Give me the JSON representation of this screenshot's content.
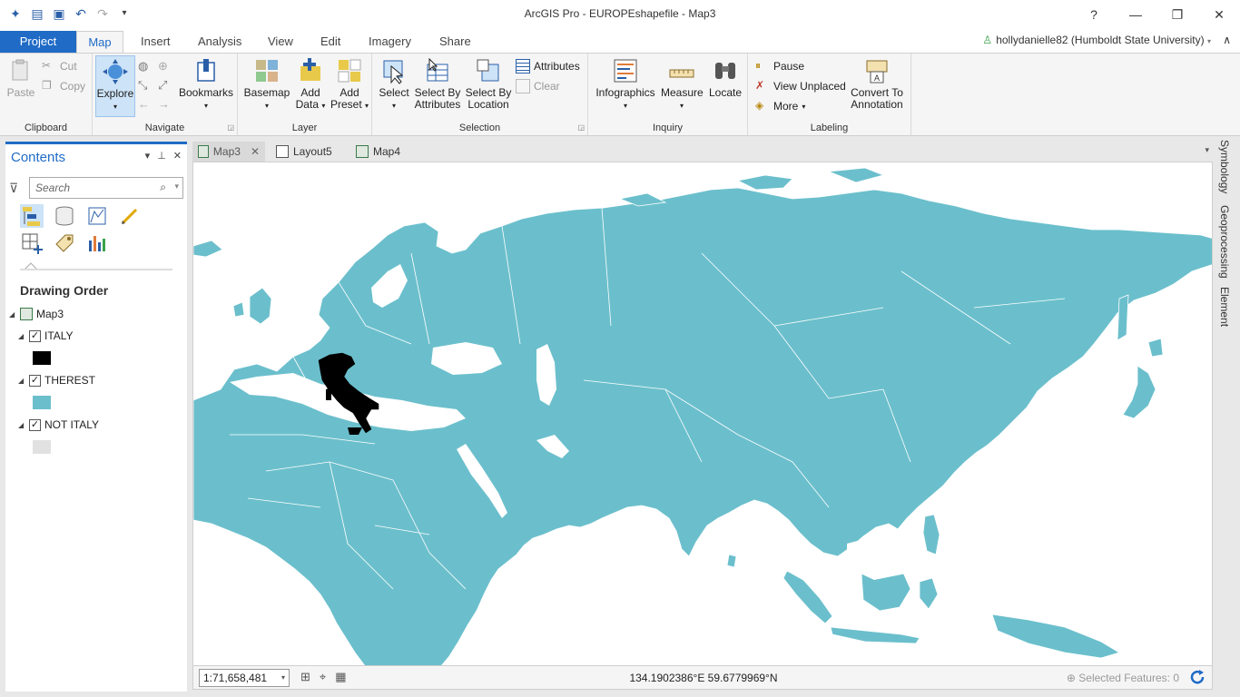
{
  "window": {
    "title": "ArcGIS Pro - EUROPEshapefile - Map3",
    "controls": {
      "help": "?",
      "minimize": "—",
      "restore": "❐",
      "close": "✕"
    }
  },
  "ribbon_tabs": [
    "Project",
    "Map",
    "Insert",
    "Analysis",
    "View",
    "Edit",
    "Imagery",
    "Share"
  ],
  "user": {
    "label": "hollydanielle82 (Humboldt State University)"
  },
  "ribbon": {
    "clipboard": {
      "label": "Clipboard",
      "paste": "Paste",
      "cut": "Cut",
      "copy": "Copy"
    },
    "navigate": {
      "label": "Navigate",
      "explore": "Explore",
      "bookmarks": "Bookmarks"
    },
    "layer": {
      "label": "Layer",
      "basemap": "Basemap",
      "add_data_1": "Add",
      "add_data_2": "Data",
      "add_preset_1": "Add",
      "add_preset_2": "Preset"
    },
    "selection": {
      "label": "Selection",
      "select": "Select",
      "sba_1": "Select By",
      "sba_2": "Attributes",
      "sbl_1": "Select By",
      "sbl_2": "Location",
      "attributes": "Attributes",
      "clear": "Clear"
    },
    "inquiry": {
      "label": "Inquiry",
      "infographics": "Infographics",
      "measure": "Measure",
      "locate": "Locate"
    },
    "labeling": {
      "label": "Labeling",
      "pause": "Pause",
      "view_unplaced": "View Unplaced",
      "more": "More",
      "convert_1": "Convert To",
      "convert_2": "Annotation"
    }
  },
  "contents": {
    "title": "Contents",
    "search_placeholder": "Search",
    "drawing_order": "Drawing Order",
    "map_name": "Map3",
    "layers": [
      {
        "name": "ITALY",
        "checked": true,
        "color": "#000000"
      },
      {
        "name": "THEREST",
        "checked": true,
        "color": "#6bbfcc"
      },
      {
        "name": "NOT ITALY",
        "checked": true,
        "color": "#e1e1e1"
      }
    ]
  },
  "view_tabs": [
    {
      "label": "Map3",
      "active": true,
      "kind": "map"
    },
    {
      "label": "Layout5",
      "active": false,
      "kind": "layout"
    },
    {
      "label": "Map4",
      "active": false,
      "kind": "map"
    }
  ],
  "side_tabs": [
    "Symbology",
    "Geoprocessing",
    "Element"
  ],
  "status": {
    "scale": "1:71,658,481",
    "coordinates": "134.1902386°E 59.6779969°N",
    "selected_features": "Selected Features: 0"
  },
  "colors": {
    "accent": "#1f6bc6",
    "land": "#6bbfcc",
    "italy": "#000000"
  }
}
